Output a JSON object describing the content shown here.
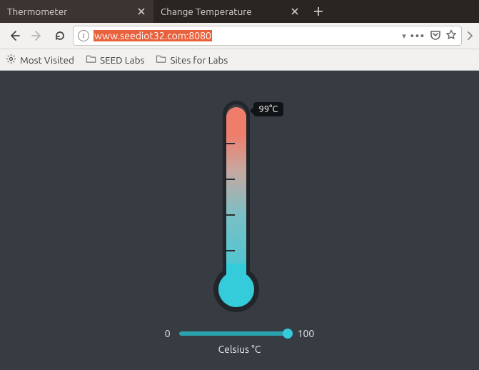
{
  "tabs": [
    {
      "title": "Thermometer",
      "active": true
    },
    {
      "title": "Change Temperature",
      "active": false
    }
  ],
  "url": {
    "full": "www.seediot32.com:8080"
  },
  "bookmarks": {
    "most_visited": "Most Visited",
    "seed_labs": "SEED Labs",
    "sites_for_labs": "Sites for Labs"
  },
  "thermometer": {
    "badge": "99°C",
    "value": 99,
    "ticks": [
      20,
      40,
      60,
      80
    ]
  },
  "slider": {
    "min_label": "0",
    "max_label": "100",
    "min": 0,
    "max": 100,
    "value": 99
  },
  "unit_label": "Celsius °C"
}
